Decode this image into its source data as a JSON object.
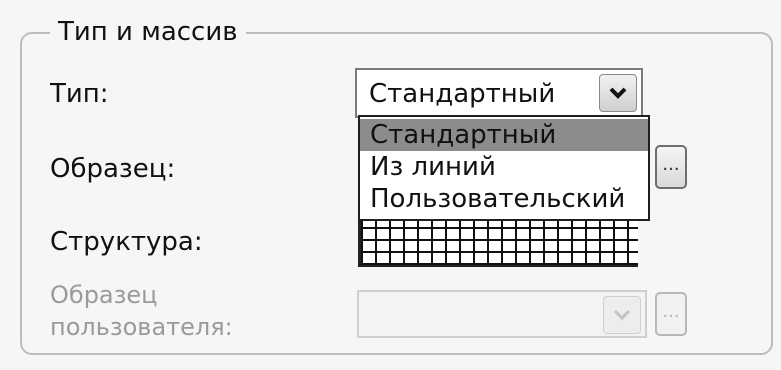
{
  "group": {
    "title": "Тип и массив"
  },
  "fields": {
    "type_label": "Тип:",
    "sample_label": "Образец:",
    "structure_label": "Структура:",
    "user_sample_label_line1": "Образец",
    "user_sample_label_line2": "пользователя:"
  },
  "type_combo": {
    "selected": "Стандартный",
    "open": true,
    "options": [
      "Стандартный",
      "Из линий",
      "Пользовательский"
    ],
    "highlighted_index": 0
  },
  "buttons": {
    "browse_label": "...",
    "user_browse_label": "..."
  },
  "user_sample_combo": {
    "value": "",
    "enabled": false
  },
  "icons": {
    "combo_arrow": "chevron-down-icon"
  }
}
